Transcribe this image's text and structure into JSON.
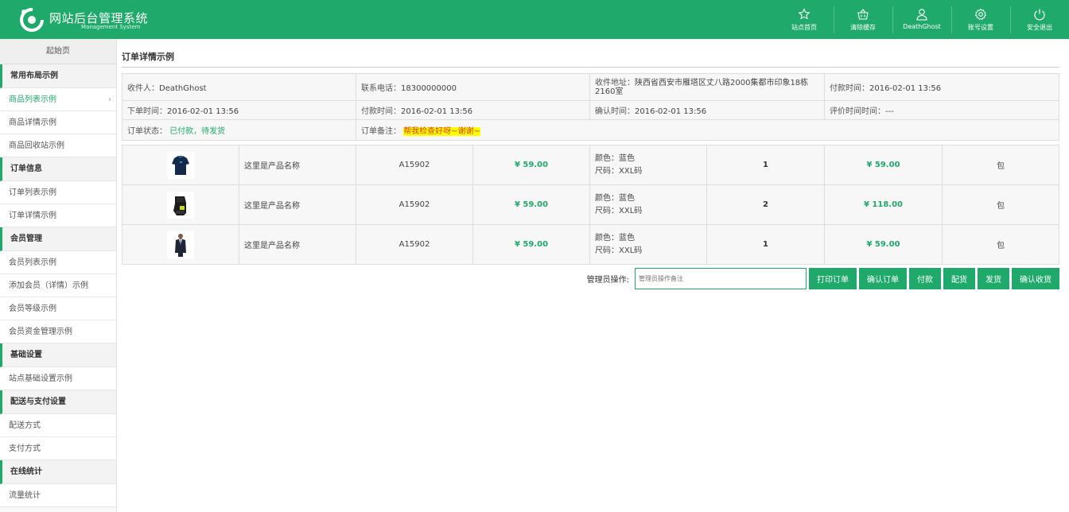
{
  "app": {
    "title_cn": "网站后台管理系统",
    "title_en": "Management System",
    "accent": "#1fa96b"
  },
  "nav": [
    {
      "label": "站点首页",
      "icon": "star-icon"
    },
    {
      "label": "清除缓存",
      "icon": "basket-icon"
    },
    {
      "label": "DeathGhost",
      "icon": "user-icon"
    },
    {
      "label": "账号设置",
      "icon": "gear-icon"
    },
    {
      "label": "安全退出",
      "icon": "power-icon"
    }
  ],
  "sidebar": {
    "start": "起始页",
    "sections": [
      {
        "title": "常用布局示例",
        "items": [
          "商品列表示例",
          "商品详情示例",
          "商品回收站示例"
        ]
      },
      {
        "title": "订单信息",
        "items": [
          "订单列表示例",
          "订单详情示例"
        ]
      },
      {
        "title": "会员管理",
        "items": [
          "会员列表示例",
          "添加会员（详情）示例",
          "会员等级示例",
          "会员资金管理示例"
        ]
      },
      {
        "title": "基础设置",
        "items": [
          "站点基础设置示例"
        ]
      },
      {
        "title": "配送与支付设置",
        "items": [
          "配送方式",
          "支付方式"
        ]
      },
      {
        "title": "在线统计",
        "items": [
          "流量统计"
        ]
      }
    ]
  },
  "page": {
    "title": "订单详情示例"
  },
  "order": {
    "receiver_label": "收件人：",
    "receiver": "DeathGhost",
    "phone_label": "联系电话：",
    "phone": "18300000000",
    "address_label": "收件地址：",
    "address_line1": "陕西省西安市雁塔区丈八路2000集都市印象18栋",
    "address_line2": "2160室",
    "pay_time_label": "付款时间：",
    "pay_time": "2016-02-01 13:56",
    "order_time_label": "下单时间：",
    "order_time": "2016-02-01 13:56",
    "pay_time2_label": "付款时间：",
    "pay_time2": "2016-02-01 13:56",
    "confirm_time_label": "确认时间：",
    "confirm_time": "2016-02-01 13:56",
    "review_time_label": "评价时间时间：",
    "review_time": "---",
    "status_label": "订单状态：",
    "status": "已付款，待发货",
    "note_label": "订单备注：",
    "note": "帮我检查好呀~谢谢~"
  },
  "products": [
    {
      "image": "shirt-thumb",
      "name": "这里是产品名称",
      "code": "A15902",
      "price": "¥ 59.00",
      "color": "颜色：蓝色",
      "size": "尺码：XXL码",
      "qty": "1",
      "total": "¥ 59.00",
      "ship": "包"
    },
    {
      "image": "glove-thumb",
      "name": "这里是产品名称",
      "code": "A15902",
      "price": "¥ 59.00",
      "color": "颜色：蓝色",
      "size": "尺码：XXL码",
      "qty": "2",
      "total": "¥ 118.00",
      "ship": "包"
    },
    {
      "image": "suit-thumb",
      "name": "这里是产品名称",
      "code": "A15902",
      "price": "¥ 59.00",
      "color": "颜色：蓝色",
      "size": "尺码：XXL码",
      "qty": "1",
      "total": "¥ 59.00",
      "ship": "包"
    }
  ],
  "actions": {
    "label": "管理员操作:",
    "placeholder": "管理员操作备注",
    "buttons": [
      "打印订单",
      "确认订单",
      "付款",
      "配货",
      "发货",
      "确认收货"
    ]
  }
}
